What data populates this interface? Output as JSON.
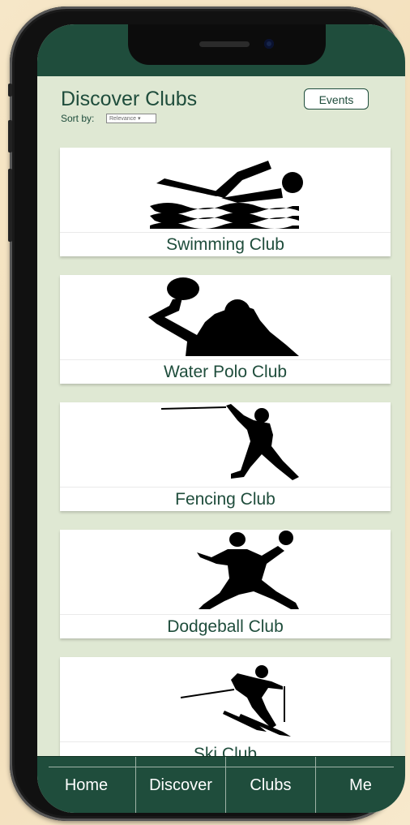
{
  "header": {
    "title": "Discover Clubs",
    "sort_label": "Sort by:",
    "sort_value": "Relevance ▾",
    "events_button": "Events"
  },
  "clubs": [
    {
      "name": "Swimming Club",
      "icon": "swimmer-icon"
    },
    {
      "name": "Water Polo Club",
      "icon": "water-polo-player-icon"
    },
    {
      "name": "Fencing Club",
      "icon": "fencer-icon"
    },
    {
      "name": "Dodgeball Club",
      "icon": "dodgeball-player-icon"
    },
    {
      "name": "Ski Club",
      "icon": "skier-icon"
    }
  ],
  "tabs": [
    "Home",
    "Discover",
    "Clubs",
    "Me"
  ],
  "colors": {
    "brand": "#1f4d3c",
    "background": "#dfe8d3"
  }
}
